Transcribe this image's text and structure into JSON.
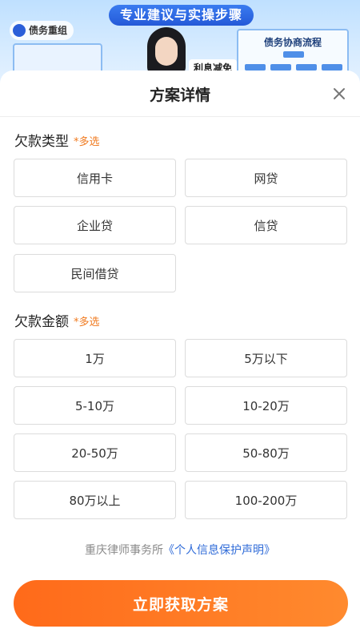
{
  "banner": {
    "title": "专业建议与实操步骤",
    "tag": "债务重组",
    "chip": "利息减免",
    "flow_title": "债务协商流程"
  },
  "sheet": {
    "title": "方案详情",
    "close_icon": "close-icon"
  },
  "debt_type": {
    "label": "欠款类型",
    "multi": "*多选",
    "options": [
      "信用卡",
      "网贷",
      "企业贷",
      "信贷",
      "民间借贷"
    ]
  },
  "debt_amount": {
    "label": "欠款金额",
    "multi": "*多选",
    "options": [
      "1万",
      "5万以下",
      "5-10万",
      "10-20万",
      "20-50万",
      "50-80万",
      "80万以上",
      "100-200万"
    ]
  },
  "notice": {
    "prefix": "重庆律师事务所",
    "link": "《个人信息保护声明》"
  },
  "cta": {
    "label": "立即获取方案"
  },
  "colors": {
    "accent": "#ff7a24",
    "link": "#2f6bd8",
    "multi": "#f07a1f"
  }
}
